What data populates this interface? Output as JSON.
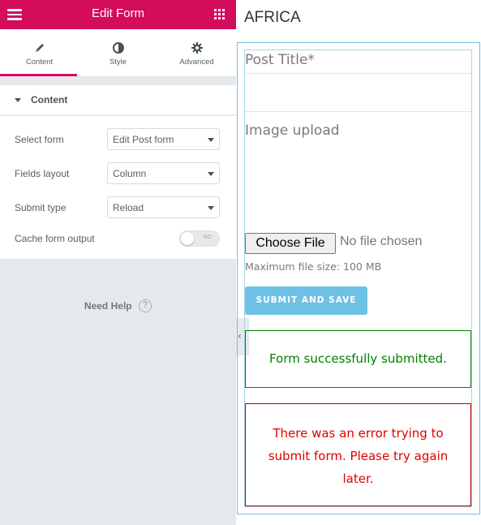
{
  "editor": {
    "title": "Edit Form",
    "tabs": [
      {
        "label": "Content",
        "icon": "pencil-icon"
      },
      {
        "label": "Style",
        "icon": "half-circle-icon"
      },
      {
        "label": "Advanced",
        "icon": "gear-icon"
      }
    ],
    "active_tab": "Content",
    "section_title": "Content",
    "controls": {
      "select_form": {
        "label": "Select form",
        "value": "Edit Post form"
      },
      "fields_layout": {
        "label": "Fields layout",
        "value": "Column"
      },
      "submit_type": {
        "label": "Submit type",
        "value": "Reload"
      },
      "cache_output": {
        "label": "Cache form output",
        "toggle_text": "NO"
      }
    },
    "help": {
      "label": "Need Help",
      "icon_glyph": "?"
    },
    "collapse_glyph": "‹"
  },
  "preview": {
    "page_title": "AFRICA",
    "form": {
      "title_label": "Post Title*",
      "image_label": "Image upload",
      "choose_file": "Choose File",
      "no_file": "No file chosen",
      "max_size": "Maximum file size: 100 MB",
      "submit": "SUBMIT AND SAVE",
      "success_message": "Form successfully submitted.",
      "error_message": "There was an error trying to submit form. Please try again later."
    }
  },
  "colors": {
    "brand": "#d30c5c",
    "accent": "#6ec1e4",
    "success": "#008000",
    "error": "#e00000"
  }
}
